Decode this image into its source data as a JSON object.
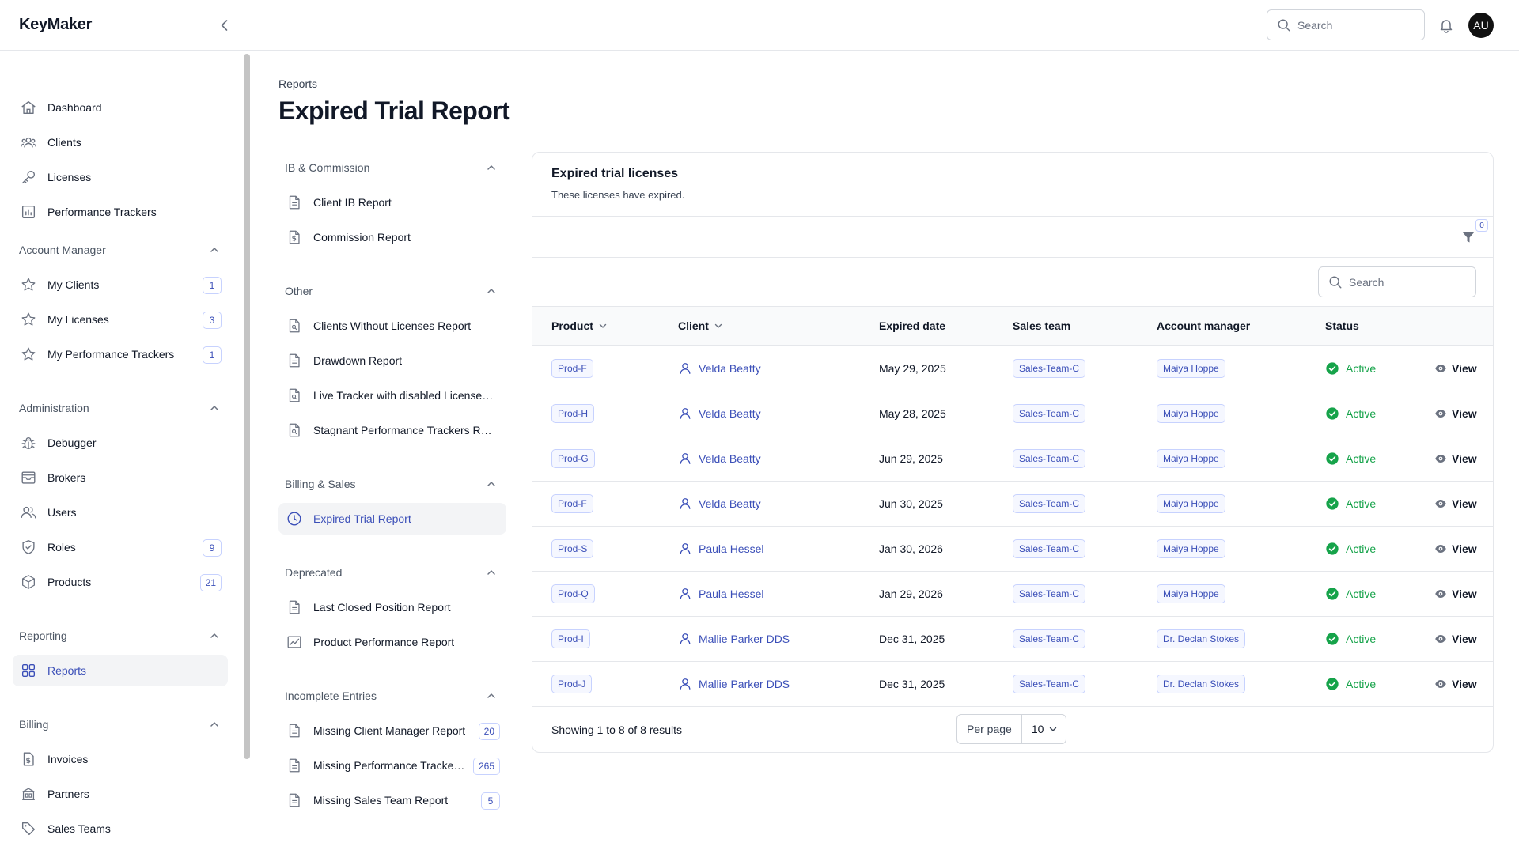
{
  "app": {
    "brand": "KeyMaker",
    "user_initials": "AU"
  },
  "topbar": {
    "search_placeholder": "Search"
  },
  "sidebar": {
    "main": [
      {
        "label": "Dashboard",
        "icon": "home-icon"
      },
      {
        "label": "Clients",
        "icon": "users-group-icon"
      },
      {
        "label": "Licenses",
        "icon": "key-icon"
      },
      {
        "label": "Performance Trackers",
        "icon": "chart-bar-icon"
      }
    ],
    "groups": [
      {
        "title": "Account Manager",
        "items": [
          {
            "label": "My Clients",
            "badge": "1",
            "icon": "star-icon"
          },
          {
            "label": "My Licenses",
            "badge": "3",
            "icon": "star-icon"
          },
          {
            "label": "My Performance Trackers",
            "badge": "1",
            "icon": "star-icon"
          }
        ]
      },
      {
        "title": "Administration",
        "items": [
          {
            "label": "Debugger",
            "badge": "",
            "icon": "bug-icon"
          },
          {
            "label": "Brokers",
            "badge": "",
            "icon": "inbox-icon"
          },
          {
            "label": "Users",
            "badge": "",
            "icon": "users-icon"
          },
          {
            "label": "Roles",
            "badge": "9",
            "icon": "shield-check-icon"
          },
          {
            "label": "Products",
            "badge": "21",
            "icon": "cube-icon"
          }
        ]
      },
      {
        "title": "Reporting",
        "items": [
          {
            "label": "Reports",
            "badge": "",
            "icon": "grid-icon",
            "active": true
          }
        ]
      },
      {
        "title": "Billing",
        "items": [
          {
            "label": "Invoices",
            "badge": "",
            "icon": "dollar-document-icon"
          },
          {
            "label": "Partners",
            "badge": "",
            "icon": "building-icon"
          },
          {
            "label": "Sales Teams",
            "badge": "",
            "icon": "tag-icon"
          }
        ]
      }
    ]
  },
  "breadcrumb": "Reports",
  "page_title": "Expired Trial Report",
  "report_nav": [
    {
      "title": "IB & Commission",
      "items": [
        {
          "label": "Client IB Report",
          "badge": ""
        },
        {
          "label": "Commission Report",
          "badge": ""
        }
      ]
    },
    {
      "title": "Other",
      "items": [
        {
          "label": "Clients Without Licenses Report",
          "badge": ""
        },
        {
          "label": "Drawdown Report",
          "badge": ""
        },
        {
          "label": "Live Tracker with disabled License Report",
          "badge": ""
        },
        {
          "label": "Stagnant Performance Trackers Report",
          "badge": ""
        }
      ]
    },
    {
      "title": "Billing & Sales",
      "items": [
        {
          "label": "Expired Trial Report",
          "badge": "",
          "active": true
        }
      ]
    },
    {
      "title": "Deprecated",
      "items": [
        {
          "label": "Last Closed Position Report",
          "badge": ""
        },
        {
          "label": "Product Performance Report",
          "badge": ""
        }
      ]
    },
    {
      "title": "Incomplete Entries",
      "items": [
        {
          "label": "Missing Client Manager Report",
          "badge": "20"
        },
        {
          "label": "Missing Performance Trackers Report",
          "badge": "265"
        },
        {
          "label": "Missing Sales Team Report",
          "badge": "5"
        }
      ]
    }
  ],
  "card": {
    "title": "Expired trial licenses",
    "subtitle": "These licenses have expired.",
    "filter_count": "0",
    "search_placeholder": "Search",
    "columns": {
      "product": "Product",
      "client": "Client",
      "expired_date": "Expired date",
      "sales_team": "Sales team",
      "account_manager": "Account manager",
      "status": "Status"
    },
    "view_label": "View",
    "rows": [
      {
        "product": "Prod-F",
        "client": "Velda Beatty",
        "expired_date": "May 29, 2025",
        "sales_team": "Sales-Team-C",
        "account_manager": "Maiya Hoppe",
        "status": "Active"
      },
      {
        "product": "Prod-H",
        "client": "Velda Beatty",
        "expired_date": "May 28, 2025",
        "sales_team": "Sales-Team-C",
        "account_manager": "Maiya Hoppe",
        "status": "Active"
      },
      {
        "product": "Prod-G",
        "client": "Velda Beatty",
        "expired_date": "Jun 29, 2025",
        "sales_team": "Sales-Team-C",
        "account_manager": "Maiya Hoppe",
        "status": "Active"
      },
      {
        "product": "Prod-F",
        "client": "Velda Beatty",
        "expired_date": "Jun 30, 2025",
        "sales_team": "Sales-Team-C",
        "account_manager": "Maiya Hoppe",
        "status": "Active"
      },
      {
        "product": "Prod-S",
        "client": "Paula Hessel",
        "expired_date": "Jan 30, 2026",
        "sales_team": "Sales-Team-C",
        "account_manager": "Maiya Hoppe",
        "status": "Active"
      },
      {
        "product": "Prod-Q",
        "client": "Paula Hessel",
        "expired_date": "Jan 29, 2026",
        "sales_team": "Sales-Team-C",
        "account_manager": "Maiya Hoppe",
        "status": "Active"
      },
      {
        "product": "Prod-I",
        "client": "Mallie Parker DDS",
        "expired_date": "Dec 31, 2025",
        "sales_team": "Sales-Team-C",
        "account_manager": "Dr. Declan Stokes",
        "status": "Active"
      },
      {
        "product": "Prod-J",
        "client": "Mallie Parker DDS",
        "expired_date": "Dec 31, 2025",
        "sales_team": "Sales-Team-C",
        "account_manager": "Dr. Declan Stokes",
        "status": "Active"
      }
    ],
    "showing": "Showing 1 to 8 of 8 results",
    "per_page_label": "Per page",
    "per_page_value": "10"
  },
  "colors": {
    "accent": "#3b4fb8",
    "success": "#16a34a",
    "border": "#e5e7eb"
  }
}
